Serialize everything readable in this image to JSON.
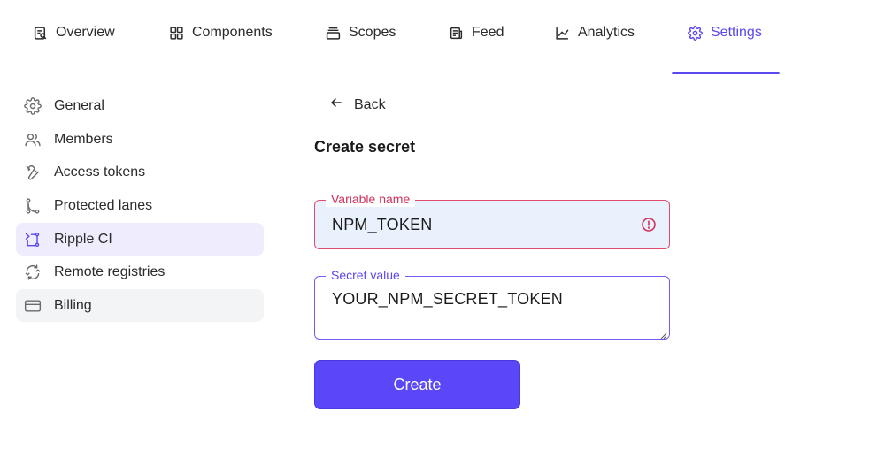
{
  "topnav": {
    "tabs": [
      {
        "label": "Overview",
        "icon": "overview-icon"
      },
      {
        "label": "Components",
        "icon": "grid-icon"
      },
      {
        "label": "Scopes",
        "icon": "stack-icon"
      },
      {
        "label": "Feed",
        "icon": "feed-icon"
      },
      {
        "label": "Analytics",
        "icon": "chart-icon"
      },
      {
        "label": "Settings",
        "icon": "gear-icon",
        "active": true
      }
    ]
  },
  "sidebar": {
    "items": [
      {
        "label": "General",
        "icon": "gear-icon"
      },
      {
        "label": "Members",
        "icon": "users-icon"
      },
      {
        "label": "Access tokens",
        "icon": "wrench-icon"
      },
      {
        "label": "Protected lanes",
        "icon": "lanes-icon"
      },
      {
        "label": "Ripple CI",
        "icon": "ripple-icon",
        "active": true
      },
      {
        "label": "Remote registries",
        "icon": "sync-icon"
      },
      {
        "label": "Billing",
        "icon": "card-icon"
      }
    ]
  },
  "main": {
    "back_label": "Back",
    "title": "Create secret",
    "variable_name": {
      "label": "Variable name",
      "value": "NPM_TOKEN",
      "status": "error"
    },
    "secret_value": {
      "label": "Secret value",
      "value": "YOUR_NPM_SECRET_TOKEN"
    },
    "create_label": "Create"
  },
  "colors": {
    "accent": "#5a48f0",
    "error": "#d0325b",
    "input_fill": "#e9f1fd",
    "active_item_bg": "#efecfd"
  }
}
